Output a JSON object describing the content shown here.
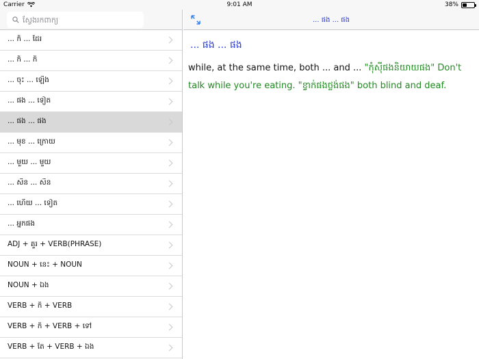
{
  "status": {
    "carrier": "Carrier",
    "time": "9:01 AM",
    "battery": "38%",
    "battery_fraction": 0.38
  },
  "search": {
    "placeholder": "ស្វែងរកពាក្យ"
  },
  "list": [
    {
      "label": "... ក៏ ... ដែរ"
    },
    {
      "label": "... ក៏ ... ក៏"
    },
    {
      "label": "... ចុះ ... ឡើង"
    },
    {
      "label": "... ផង ... ទៀត"
    },
    {
      "label": "... ផង ... ផង"
    },
    {
      "label": "... មុខ ... ក្រោយ"
    },
    {
      "label": "... មួយ ... មួយ"
    },
    {
      "label": "... សិន ... សិន"
    },
    {
      "label": "... ហើយ ... ទៀត"
    },
    {
      "label": "... អ្នកផង"
    },
    {
      "label": "ADJ + គួរ + VERB(PHRASE)"
    },
    {
      "label": "NOUN + នេះ + NOUN"
    },
    {
      "label": "NOUN + ឯង"
    },
    {
      "label": "VERB + ក៏ + VERB"
    },
    {
      "label": "VERB + ក៏ + VERB + ទៅ"
    },
    {
      "label": "VERB + តែ + VERB + ឯង"
    }
  ],
  "selected_index": 4,
  "detail": {
    "nav_title": "... ផង ... ផង",
    "headword": "... ផង ... ផង",
    "definition": "while, at the same time, both ... and ...",
    "example1": "\"កុំស៊ីផងនិយាយផង\" Don't talk while you're eating.",
    "example2": "\"ខ្វាក់ផងថ្លង់ផង\" both blind and deaf."
  },
  "colors": {
    "accent": "#2b3ad6",
    "example": "#1e8b1e",
    "selected_row": "#d9d9d9"
  },
  "icons": {
    "search": "magnifier",
    "wifi": "wifi-icon",
    "expand": "diagonal-expand-arrows",
    "chevron": "chevron-right"
  }
}
